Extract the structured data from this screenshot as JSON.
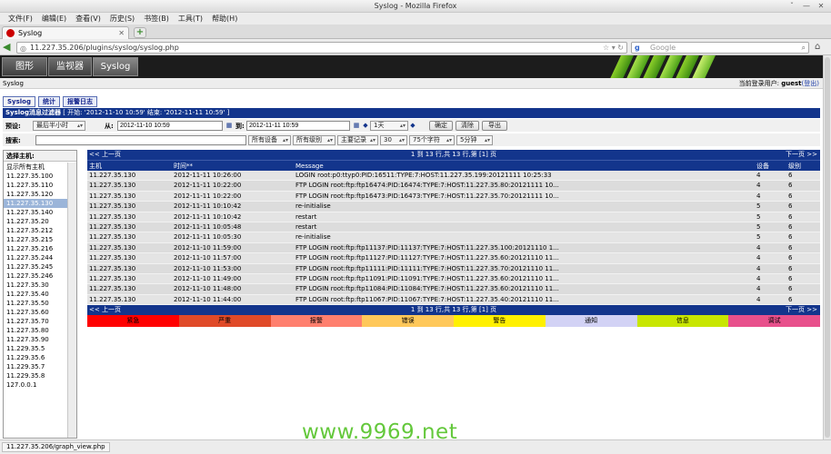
{
  "window": {
    "title": "Syslog - Mozilla Firefox",
    "controls": [
      "ˇ",
      "—",
      "✕"
    ]
  },
  "menu": [
    "文件(F)",
    "编辑(E)",
    "查看(V)",
    "历史(S)",
    "书签(B)",
    "工具(T)",
    "帮助(H)"
  ],
  "tab": {
    "title": "Syslog",
    "close": "✕",
    "new": "+"
  },
  "nav": {
    "url": "11.227.35.206/plugins/syslog/syslog.php",
    "search_placeholder": "Google"
  },
  "cacti_tabs": [
    "图形",
    "监视器",
    "Syslog"
  ],
  "breadcrumb": "Syslog",
  "user": {
    "prefix": "当前登录用户: ",
    "name": "guest",
    "logout": "(登出)"
  },
  "subtabs": [
    "Syslog",
    "统计",
    "报警日志"
  ],
  "filter": {
    "title": "Syslog消息过滤器",
    "range": " [ 开始: '2012-11-10 10:59' 结束: '2012-11-11 10:59' ]",
    "preset_label": "预设:",
    "preset_value": "最后半小时",
    "from_label": "从:",
    "from_value": "2012-11-10 10:59",
    "to_label": "到:",
    "to_value": "2012-11-11 10:59",
    "span_value": "1天",
    "buttons": {
      "go": "确定",
      "clear": "清除",
      "export": "导出"
    },
    "search_label": "搜索:",
    "search_value": "",
    "device": "所有设备",
    "level": "所有级别",
    "records": "主要记录",
    "rows": "30",
    "chars": "75个字符",
    "refresh": "5分钟"
  },
  "hosts": {
    "header": "选择主机:",
    "items": [
      "显示所有主机",
      "11.227.35.100",
      "11.227.35.110",
      "11.227.35.120",
      "11.227.35.130",
      "11.227.35.140",
      "11.227.35.20",
      "11.227.35.212",
      "11.227.35.215",
      "11.227.35.216",
      "11.227.35.244",
      "11.227.35.245",
      "11.227.35.246",
      "11.227.35.30",
      "11.227.35.40",
      "11.227.35.50",
      "11.227.35.60",
      "11.227.35.70",
      "11.227.35.80",
      "11.227.35.90",
      "11.229.35.5",
      "11.229.35.6",
      "11.229.35.7",
      "11.229.35.8",
      "127.0.0.1"
    ],
    "selected_index": 4
  },
  "pager": {
    "prev": "<< 上一页",
    "info": "1 到 13 行,共 13 行,第 [1] 页",
    "next": "下一页 >>"
  },
  "columns": [
    "主机",
    "时间**",
    "Message",
    "设备",
    "级别"
  ],
  "rows": [
    [
      "11.227.35.130",
      "2012-11-11 10:26:00",
      "LOGIN root:p0:ttyp0:PID:16511:TYPE:7:HOST:11.227.35.199:20121111 10:25:33",
      "4",
      "6"
    ],
    [
      "11.227.35.130",
      "2012-11-11 10:22:00",
      "FTP LOGIN root:ftp:ftp16474:PID:16474:TYPE:7:HOST:11.227.35.80:20121111 10...",
      "4",
      "6"
    ],
    [
      "11.227.35.130",
      "2012-11-11 10:22:00",
      "FTP LOGIN root:ftp:ftp16473:PID:16473:TYPE:7:HOST:11.227.35.70:20121111 10...",
      "4",
      "6"
    ],
    [
      "11.227.35.130",
      "2012-11-11 10:10:42",
      "re-initialise",
      "5",
      "6"
    ],
    [
      "11.227.35.130",
      "2012-11-11 10:10:42",
      "restart",
      "5",
      "6"
    ],
    [
      "11.227.35.130",
      "2012-11-11 10:05:48",
      "restart",
      "5",
      "6"
    ],
    [
      "11.227.35.130",
      "2012-11-11 10:05:30",
      "re-initialise",
      "5",
      "6"
    ],
    [
      "11.227.35.130",
      "2012-11-10 11:59:00",
      "FTP LOGIN root:ftp:ftp11137:PID:11137:TYPE:7:HOST:11.227.35.100:20121110 1...",
      "4",
      "6"
    ],
    [
      "11.227.35.130",
      "2012-11-10 11:57:00",
      "FTP LOGIN root:ftp:ftp11127:PID:11127:TYPE:7:HOST:11.227.35.60:20121110 11...",
      "4",
      "6"
    ],
    [
      "11.227.35.130",
      "2012-11-10 11:53:00",
      "FTP LOGIN root:ftp:ftp11111:PID:11111:TYPE:7:HOST:11.227.35.70:20121110 11...",
      "4",
      "6"
    ],
    [
      "11.227.35.130",
      "2012-11-10 11:49:00",
      "FTP LOGIN root:ftp:ftp11091:PID:11091:TYPE:7:HOST:11.227.35.60:20121110 11...",
      "4",
      "6"
    ],
    [
      "11.227.35.130",
      "2012-11-10 11:48:00",
      "FTP LOGIN root:ftp:ftp11084:PID:11084:TYPE:7:HOST:11.227.35.60:20121110 11...",
      "4",
      "6"
    ],
    [
      "11.227.35.130",
      "2012-11-10 11:44:00",
      "FTP LOGIN root:ftp:ftp11067:PID:11067:TYPE:7:HOST:11.227.35.40:20121110 11...",
      "4",
      "6"
    ]
  ],
  "legend": [
    {
      "label": "紧急",
      "color": "#ff0000"
    },
    {
      "label": "严重",
      "color": "#e04a28"
    },
    {
      "label": "报警",
      "color": "#ff7f6e"
    },
    {
      "label": "错误",
      "color": "#ffc85a"
    },
    {
      "label": "警告",
      "color": "#fff000"
    },
    {
      "label": "通知",
      "color": "#d2d2f5"
    },
    {
      "label": "信息",
      "color": "#c8e600"
    },
    {
      "label": "调试",
      "color": "#e8508c"
    }
  ],
  "watermark": "www.9969.net",
  "status": "11.227.35.206/graph_view.php",
  "colors": {
    "accent": "#13358c",
    "header_bg": "#1c1c1c",
    "selected_host": "#9bb5d9"
  }
}
